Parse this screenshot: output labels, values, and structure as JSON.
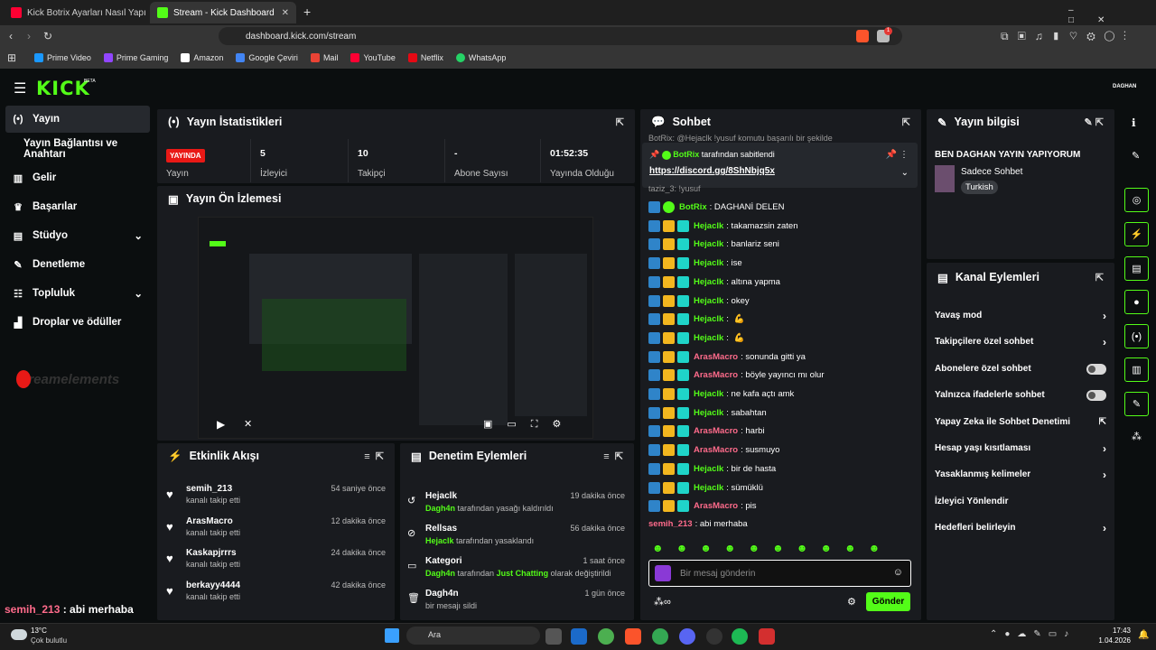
{
  "browser": {
    "tabs": [
      {
        "title": "Kick Botrix Ayarları Nasıl Yapılır? Takip",
        "icon": "youtube-icon"
      },
      {
        "title": "Stream - Kick Dashboard",
        "icon": "kick-icon"
      }
    ],
    "new_tab": "+",
    "url": "dashboard.kick.com/stream",
    "bookmarks": [
      "Prime Video",
      "Prime Gaming",
      "Amazon",
      "Google Çeviri",
      "Mail",
      "YouTube",
      "Netflix",
      "WhatsApp"
    ],
    "extension_badge": "1"
  },
  "app": {
    "logo": "KICK",
    "logo_beta": "BETA",
    "user": "DAGHAN",
    "nav": [
      {
        "label": "Yayın",
        "icon": "broadcast-icon",
        "active": true
      },
      {
        "label": "Yayın Bağlantısı ve Anahtarı",
        "icon": "",
        "active": false
      },
      {
        "label": "Gelir",
        "icon": "chart-icon"
      },
      {
        "label": "Başarılar",
        "icon": "trophy-icon"
      },
      {
        "label": "Stüdyo",
        "icon": "studio-icon"
      },
      {
        "label": "Denetleme",
        "icon": "wrench-icon"
      },
      {
        "label": "Topluluk",
        "icon": "community-icon"
      },
      {
        "label": "Droplar ve ödüller",
        "icon": "drops-icon"
      }
    ],
    "overlay_logo": "streamelements",
    "overlay_chat": {
      "user": "semih_213",
      "message": " : abi merhaba"
    }
  },
  "stats": {
    "title": "Yayın İstatistikleri",
    "badge": "YAYINDA",
    "items": [
      {
        "label": "Yayın",
        "value": ""
      },
      {
        "label": "İzleyici",
        "value": "5"
      },
      {
        "label": "Takipçi",
        "value": "10"
      },
      {
        "label": "Abone Sayısı",
        "value": "-"
      },
      {
        "label": "Yayında Olduğu",
        "value": "01:52:35"
      }
    ]
  },
  "preview": {
    "title": "Yayın Ön İzlemesi"
  },
  "activity": {
    "title": "Etkinlik Akışı",
    "items": [
      {
        "name": "semih_213",
        "sub": "kanalı takip etti",
        "time": "54 saniye önce"
      },
      {
        "name": "ArasMacro",
        "sub": "kanalı takip etti",
        "time": "12 dakika önce"
      },
      {
        "name": "Kaskapjrrrs",
        "sub": "kanalı takip etti",
        "time": "24 dakika önce"
      },
      {
        "name": "berkayy4444",
        "sub": "kanalı takip etti",
        "time": "42 dakika önce"
      }
    ]
  },
  "moderation": {
    "title": "Denetim Eylemleri",
    "items": [
      {
        "name": "Hejaclk",
        "actor": "Dagh4n",
        "sub": " tarafından yasağı kaldırıldı",
        "extra": "",
        "extra2": "",
        "time": "19 dakika önce",
        "icon": "undo-icon"
      },
      {
        "name": "Rellsas",
        "actor": "Hejaclk",
        "sub": " tarafından yasaklandı",
        "extra": "",
        "extra2": "",
        "time": "56 dakika önce",
        "icon": "ban-icon"
      },
      {
        "name": "Kategori",
        "actor": "Dagh4n",
        "sub": " tarafından ",
        "extra": "Just Chatting",
        "extra2": " olarak değiştirildi",
        "time": "1 saat önce",
        "icon": "category-icon"
      },
      {
        "name": "Dagh4n",
        "actor": "",
        "sub": "bir mesajı sildi",
        "extra": "",
        "extra2": "",
        "time": "1 gün önce",
        "icon": "trash-icon"
      }
    ]
  },
  "chat": {
    "title": "Sohbet",
    "pinned_by": "BotRix",
    "pinned_text": " tarafından sabitlendi",
    "pinned_link": "https://discord.gg/8ShNbjq5x",
    "partial_top": "BotRix: @Hejaclk !yusuf komutu başarılı bir şekilde",
    "partial_top2": "taziz_3: !yusuf",
    "messages": [
      {
        "user": "BotRix",
        "color": "#53fc18",
        "text": ": DAGHANİ DELEN",
        "bot": true
      },
      {
        "user": "Hejaclk",
        "color": "#53fc18",
        "text": ": takamazsin zaten"
      },
      {
        "user": "Hejaclk",
        "color": "#53fc18",
        "text": ": banlariz seni"
      },
      {
        "user": "Hejaclk",
        "color": "#53fc18",
        "text": ": ise"
      },
      {
        "user": "Hejaclk",
        "color": "#53fc18",
        "text": ": altına yapma"
      },
      {
        "user": "Hejaclk",
        "color": "#53fc18",
        "text": ": okey"
      },
      {
        "user": "Hejaclk",
        "color": "#53fc18",
        "text": ":",
        "emote": true
      },
      {
        "user": "Hejaclk",
        "color": "#53fc18",
        "text": ":",
        "emote": true
      },
      {
        "user": "ArasMacro",
        "color": "#ff6b8b",
        "text": ": sonunda gitti ya"
      },
      {
        "user": "ArasMacro",
        "color": "#ff6b8b",
        "text": ": böyle yayıncı mı olur"
      },
      {
        "user": "Hejaclk",
        "color": "#53fc18",
        "text": ": ne kafa açtı amk"
      },
      {
        "user": "Hejaclk",
        "color": "#53fc18",
        "text": ": sabahtan"
      },
      {
        "user": "ArasMacro",
        "color": "#ff6b8b",
        "text": ": harbi"
      },
      {
        "user": "ArasMacro",
        "color": "#ff6b8b",
        "text": ": susmuyo"
      },
      {
        "user": "Hejaclk",
        "color": "#53fc18",
        "text": ": bir de hasta"
      },
      {
        "user": "Hejaclk",
        "color": "#53fc18",
        "text": ": sümüklü"
      },
      {
        "user": "ArasMacro",
        "color": "#ff6b8b",
        "text": ": pis"
      }
    ],
    "last": {
      "user": "semih_213",
      "text": ": abi merhaba"
    },
    "placeholder": "Bir mesaj gönderin",
    "send": "Gönder"
  },
  "stream_info": {
    "title": "Yayın bilgisi",
    "stream_title": "BEN DAGHAN YAYIN YAPIYORUM",
    "category": "Sadece Sohbet",
    "tag": "Turkish"
  },
  "channel_actions": {
    "title": "Kanal Eylemleri",
    "items": [
      {
        "label": "Yavaş mod",
        "control": "chevron"
      },
      {
        "label": "Takipçilere özel sohbet",
        "control": "chevron"
      },
      {
        "label": "Abonelere özel sohbet",
        "control": "toggle"
      },
      {
        "label": "Yalnızca ifadelerle sohbet",
        "control": "toggle"
      },
      {
        "label": "Yapay Zeka ile Sohbet Denetimi",
        "control": "external"
      },
      {
        "label": "Hesap yaşı kısıtlaması",
        "control": "chevron"
      },
      {
        "label": "Yasaklanmış kelimeler",
        "control": "chevron"
      },
      {
        "label": "İzleyici Yönlendir",
        "control": "none"
      },
      {
        "label": "Hedefleri belirleyin",
        "control": "chevron"
      }
    ]
  },
  "taskbar": {
    "weather_temp": "13°C",
    "weather_desc": "Çok bulutlu",
    "search": "Ara",
    "time": "17:43",
    "date": "1.04.2026"
  },
  "colors": {
    "accent": "#53fc18",
    "panel": "#191b1f",
    "live": "#e91916"
  }
}
